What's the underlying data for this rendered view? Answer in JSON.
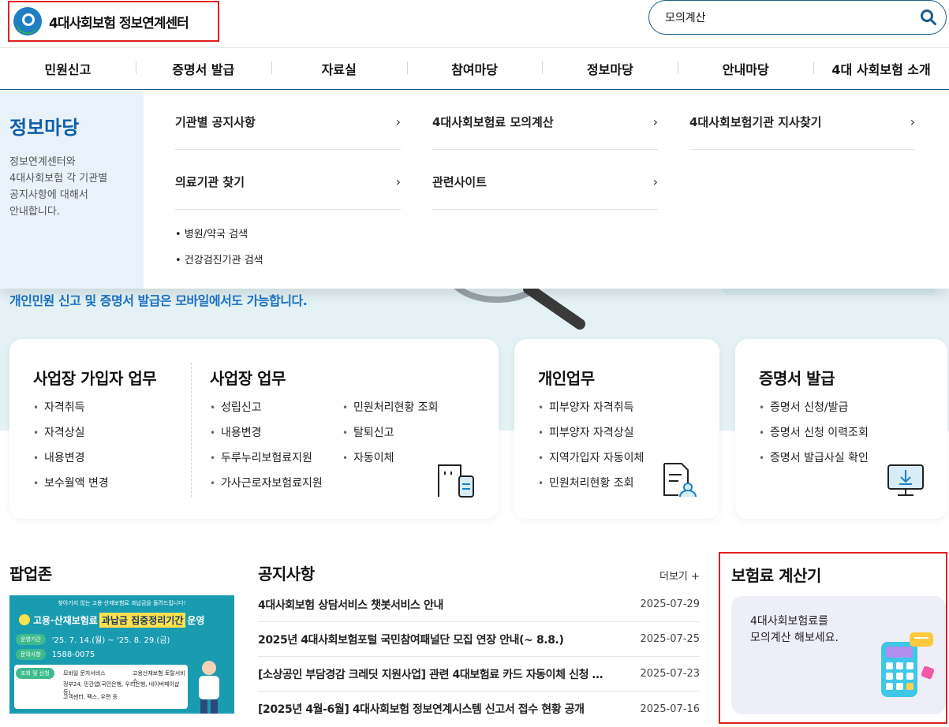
{
  "header": {
    "logo_text": "4대사회보험 정보연계센터",
    "search_value": "모의계산"
  },
  "gnb": [
    "민원신고",
    "증명서 발급",
    "자료실",
    "참여마당",
    "정보마당",
    "안내마당",
    "4대 사회보험 소개"
  ],
  "mega_menu": {
    "title": "정보마당",
    "description": [
      "정보연계센터와",
      "4대사회보험 각 기관별",
      "공지사항에 대해서",
      "안내합니다."
    ],
    "links": [
      "기관별 공지사항",
      "4대사회보험료 모의계산",
      "4대사회보험기관 지사찾기",
      "의료기관 찾기",
      "관련사이트"
    ],
    "sub_links": [
      "• 병원/약국 검색",
      "• 건강검진기관 검색"
    ]
  },
  "hero": {
    "text": "개인민원 신고 및 증명서 발급은 모바일에서도 가능합니다."
  },
  "cards": {
    "subscriber": {
      "title": "사업장 가입자 업무",
      "items": [
        "자격취득",
        "자격상실",
        "내용변경",
        "보수월액 변경"
      ]
    },
    "workplace": {
      "title": "사업장 업무",
      "col1": [
        "성립신고",
        "내용변경",
        "두루누리보험료지원",
        "가사근로자보험료지원"
      ],
      "col2": [
        "민원처리현황 조회",
        "탈퇴신고",
        "자동이체"
      ]
    },
    "personal": {
      "title": "개인업무",
      "items": [
        "피부양자 자격취득",
        "피부양자 자격상실",
        "지역가입자 자동이체",
        "민원처리현황 조회"
      ]
    },
    "certificate": {
      "title": "증명서 발급",
      "items": [
        "증명서 신청/발급",
        "증명서 신청 이력조회",
        "증명서 발급사실 확인"
      ]
    }
  },
  "popup": {
    "title": "팝업존",
    "banner": {
      "top_text": "찾아가지 않는 고용·산재보험료 과납금을 돌려드립니다!",
      "headline_pre": "고용·산재보험료",
      "headline_highlight": "과납금 집중정리기간",
      "headline_post": "운영",
      "period_tag": "운영기간",
      "period": "'25. 7. 14.(월) ~ '25. 8. 29.(금)",
      "inquiry_tag": "문의사항",
      "inquiry": "1588-0075",
      "lookup_tag": "조회 및 신청",
      "lookup_items": [
        "모바일 문자서비스",
        "고용산재보험 토탈서비스",
        "정부24, 민간앱(국민은행, 우리은행, 네이버페이샵 등)",
        "고객센터, 팩스, 우편 등"
      ]
    }
  },
  "notice": {
    "title": "공지사항",
    "more_label": "더보기 +",
    "rows": [
      {
        "title": "4대사회보험 상담서비스 챗봇서비스 안내",
        "date": "2025-07-29"
      },
      {
        "title": "2025년 4대사회보험포털 국민참여패널단 모집 연장 안내(~ 8.8.)",
        "date": "2025-07-25"
      },
      {
        "title": "[소상공인 부담경감 크레딧 지원사업] 관련 4대보험료 카드 자동이체 신청 …",
        "date": "2025-07-23"
      },
      {
        "title": "[2025년 4월-6월] 4대사회보험 정보연계시스템 신고서 접수 현황 공개",
        "date": "2025-07-16"
      }
    ]
  },
  "calculator": {
    "title": "보험료 계산기",
    "line1": "4대사회보험료를",
    "line2": "모의계산 해보세요."
  },
  "colors": {
    "brand_blue": "#1a5d8a",
    "accent_blue": "#0d5ea8",
    "highlight_red": "#e02020"
  }
}
